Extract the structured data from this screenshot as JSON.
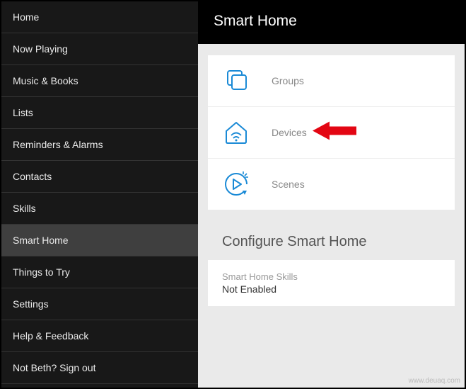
{
  "sidebar": {
    "items": [
      {
        "label": "Home",
        "active": false
      },
      {
        "label": "Now Playing",
        "active": false
      },
      {
        "label": "Music & Books",
        "active": false
      },
      {
        "label": "Lists",
        "active": false
      },
      {
        "label": "Reminders & Alarms",
        "active": false
      },
      {
        "label": "Contacts",
        "active": false
      },
      {
        "label": "Skills",
        "active": false
      },
      {
        "label": "Smart Home",
        "active": true
      },
      {
        "label": "Things to Try",
        "active": false
      },
      {
        "label": "Settings",
        "active": false
      },
      {
        "label": "Help & Feedback",
        "active": false
      },
      {
        "label": "Not Beth? Sign out",
        "active": false
      }
    ]
  },
  "header": {
    "title": "Smart Home"
  },
  "tiles": [
    {
      "id": "groups",
      "label": "Groups",
      "icon": "groups-icon",
      "highlighted": false
    },
    {
      "id": "devices",
      "label": "Devices",
      "icon": "devices-icon",
      "highlighted": true
    },
    {
      "id": "scenes",
      "label": "Scenes",
      "icon": "scenes-icon",
      "highlighted": false
    }
  ],
  "configure": {
    "title": "Configure Smart Home"
  },
  "skills_block": {
    "label": "Smart Home Skills",
    "value": "Not Enabled"
  },
  "watermark": "www.deuaq.com",
  "colors": {
    "accent": "#1a8ad6",
    "arrow": "#e30613"
  }
}
